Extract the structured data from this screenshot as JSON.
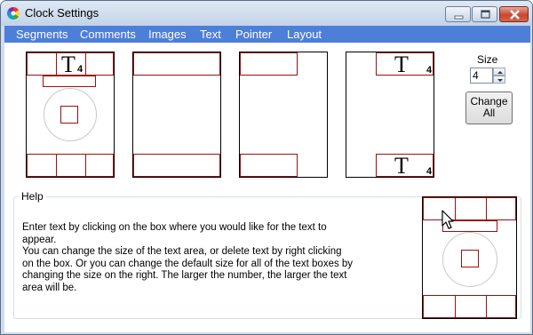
{
  "window": {
    "title": "Clock Settings",
    "accent_menubar": "#4d7fd8",
    "border_red": "#9b1010",
    "icon": "color-wheel-icon"
  },
  "menu": {
    "items": [
      "Segments",
      "Comments",
      "Images",
      "Text",
      "Pointer",
      "Layout"
    ]
  },
  "layouts": [
    {
      "name": "Clock with top and bottom text",
      "has_clock": true,
      "top_text": "T",
      "top_size": "4",
      "bottom_cells": 3
    },
    {
      "name": "Top and bottom text",
      "has_clock": false
    },
    {
      "name": "Left top and bottom text",
      "has_clock": false
    },
    {
      "name": "Right top and bottom text",
      "has_clock": false,
      "top_text": "T",
      "top_size": "4",
      "bottom_text": "T",
      "bottom_size": "4"
    }
  ],
  "size": {
    "label": "Size",
    "value": "4",
    "change_all_line1": "Change",
    "change_all_line2": "All"
  },
  "help": {
    "title": "Help",
    "para1": "Enter text by clicking on the box where you would like for the text to appear.",
    "para2": "You can change the size of the text area, or delete text by right clicking on the box.  Or you can change the default size for all of the text boxes by changing the size on the right.  The larger the number, the larger the text area will be."
  }
}
